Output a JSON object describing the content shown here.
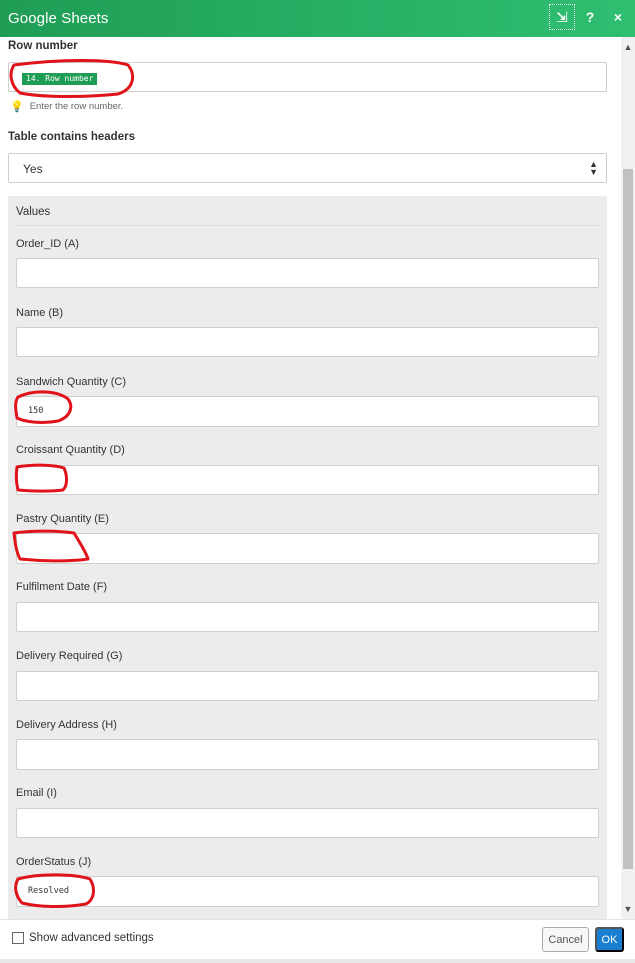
{
  "window": {
    "title": "Google Sheets"
  },
  "header_icons": [
    "collapse-icon",
    "help-icon",
    "close-icon"
  ],
  "header_glyphs": {
    "collapse": "⇲",
    "help": "?",
    "close": "×"
  },
  "row_number": {
    "label": "Row number",
    "value_pill": "14. Row number",
    "hint": "Enter the row number."
  },
  "table_headers": {
    "label": "Table contains headers",
    "selected": "Yes"
  },
  "values_panel": {
    "title": "Values",
    "fields": [
      {
        "label": "Order_ID (A)",
        "value": ""
      },
      {
        "label": "Name (B)",
        "value": ""
      },
      {
        "label": "Sandwich Quantity (C)",
        "value": "150"
      },
      {
        "label": "Croissant Quantity (D)",
        "value": ""
      },
      {
        "label": "Pastry Quantity (E)",
        "value": ""
      },
      {
        "label": "Fulfilment Date (F)",
        "value": ""
      },
      {
        "label": "Delivery Required (G)",
        "value": ""
      },
      {
        "label": "Delivery Address (H)",
        "value": ""
      },
      {
        "label": "Email (I)",
        "value": ""
      },
      {
        "label": "OrderStatus (J)",
        "value": "Resolved"
      }
    ]
  },
  "footer": {
    "advanced_label": "Show advanced settings",
    "cancel_label": "Cancel",
    "ok_label": "OK"
  },
  "colors": {
    "header_green": "#1f9d55",
    "pill_green": "#1f9d55",
    "ok_blue": "#1b7fd1",
    "annotation_red": "#e0131b"
  }
}
